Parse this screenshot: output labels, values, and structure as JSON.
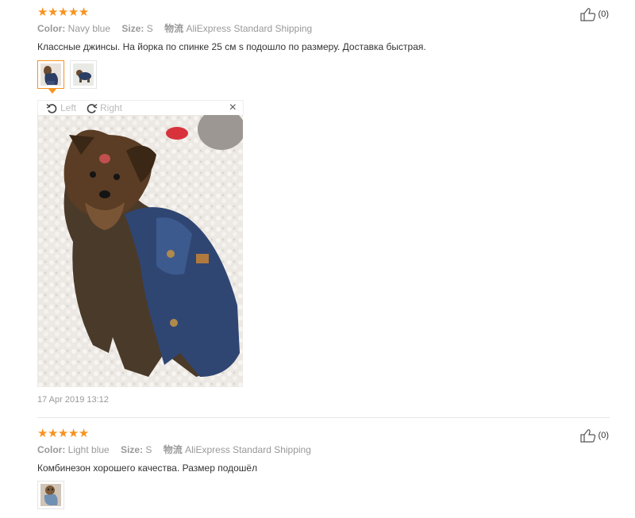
{
  "reviews": [
    {
      "rating": 5,
      "color_label": "Color:",
      "color_value": "Navy blue",
      "size_label": "Size:",
      "size_value": "S",
      "shipping_label": "物流",
      "shipping_value": "AliExpress Standard Shipping",
      "text": "Классные джинсы. На йорка по спинке 25 см s подошло по размеру. Доставка быстрая.",
      "likes": "(0)",
      "viewer": {
        "rotate_left": "Left",
        "rotate_right": "Right",
        "close": "×"
      },
      "date": "17 Apr 2019 13:12"
    },
    {
      "rating": 5,
      "color_label": "Color:",
      "color_value": "Light blue",
      "size_label": "Size:",
      "size_value": "S",
      "shipping_label": "物流",
      "shipping_value": "AliExpress Standard Shipping",
      "text": "Комбинезон хорошего качества. Размер подошёл",
      "likes": "(0)"
    }
  ],
  "icons": {
    "star": "star-icon",
    "like": "thumbs-up-icon",
    "rotate_left": "rotate-left-icon",
    "rotate_right": "rotate-right-icon",
    "close": "close-icon"
  },
  "colors": {
    "star": "#f7931e",
    "active_thumb": "#f7931e",
    "meta": "#999999",
    "text": "#333333"
  }
}
